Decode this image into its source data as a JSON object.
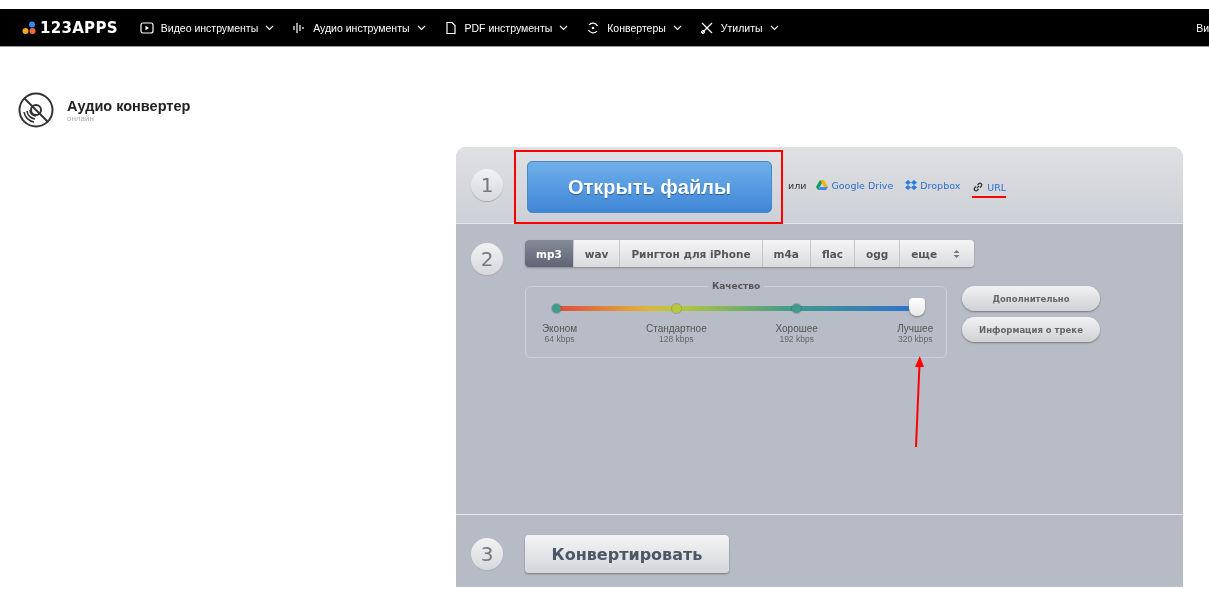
{
  "nav": {
    "logo": "123APPS",
    "items": [
      {
        "label": "Видео инструменты"
      },
      {
        "label": "Аудио инструменты"
      },
      {
        "label": "PDF инструменты"
      },
      {
        "label": "Конвертеры"
      },
      {
        "label": "Утилиты"
      }
    ],
    "cut_item": "Ви"
  },
  "header": {
    "title": "Аудио конвертер",
    "subtitle": "онлайн"
  },
  "step1": {
    "number": "1",
    "button": "Открыть файлы",
    "or_text": "или",
    "sources": [
      {
        "label": "Google Drive"
      },
      {
        "label": "Dropbox"
      },
      {
        "label": "URL"
      }
    ]
  },
  "step2": {
    "number": "2",
    "formats": [
      {
        "label": "mp3",
        "selected": true
      },
      {
        "label": "wav",
        "selected": false
      },
      {
        "label": "Рингтон для iPhone",
        "selected": false
      },
      {
        "label": "m4a",
        "selected": false
      },
      {
        "label": "flac",
        "selected": false
      },
      {
        "label": "ogg",
        "selected": false
      }
    ],
    "more": "еще",
    "quality": {
      "title": "Качество",
      "level": 1,
      "stops": [
        {
          "name": "Эконом",
          "bitrate": "64 kbps"
        },
        {
          "name": "Стандартное",
          "bitrate": "128 kbps"
        },
        {
          "name": "Хорошее",
          "bitrate": "192 kbps"
        },
        {
          "name": "Лучшее",
          "bitrate": "320 kbps"
        }
      ]
    },
    "buttons": [
      "Дополнительно",
      "Информация о треке"
    ]
  },
  "step3": {
    "number": "3",
    "button": "Конвертировать"
  }
}
